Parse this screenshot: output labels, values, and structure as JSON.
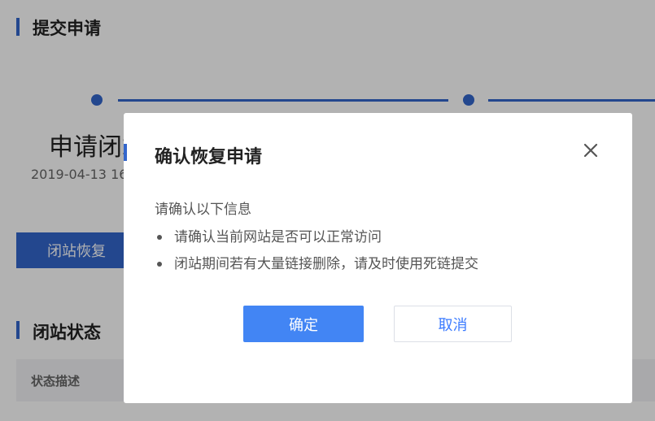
{
  "page": {
    "submit_section_title": "提交申请",
    "apply_heading": "申请闭站",
    "apply_time": "2019-04-13 16",
    "restore_button": "闭站恢复",
    "status_section_title": "闭站状态",
    "table_header_status": "状态描述"
  },
  "modal": {
    "title": "确认恢复申请",
    "intro": "请确认以下信息",
    "items": [
      "请确认当前网站是否可以正常访问",
      "闭站期间若有大量链接删除，请及时使用死链提交"
    ],
    "confirm_label": "确定",
    "cancel_label": "取消",
    "close_icon": "close-icon"
  },
  "colors": {
    "accent": "#3366cc",
    "confirm_bg": "#4285f4",
    "cancel_text": "#3b7bff",
    "overlay": "rgba(0,0,0,0.30)"
  }
}
